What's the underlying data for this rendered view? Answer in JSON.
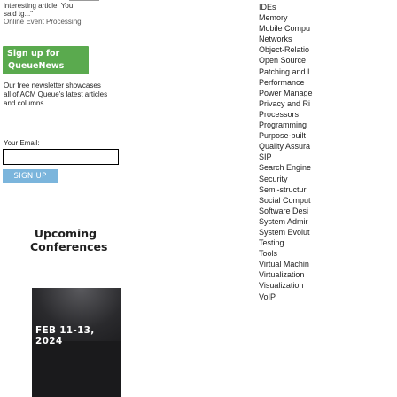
{
  "testimonial": {
    "line1": "interesting article! You",
    "line2": "said tg...\"",
    "byline": "Online Event Processing"
  },
  "newsletter": {
    "banner_line1": "Sign up for",
    "banner_line2": "QueueNews",
    "description": "Our free newsletter showcases all of ACM Queue's latest articles and columns.",
    "email_label": "Your Email:",
    "email_value": "",
    "signup_label": "SIGN UP"
  },
  "conferences": {
    "heading_line1": "Upcoming",
    "heading_line2": "Conferences",
    "event_date": "FEB 11-13, 2024"
  },
  "topics": [
    "IDEs",
    "Memory",
    "Mobile Compu",
    "Networks",
    "Object-Relatio",
    "Open Source",
    "Patching and I",
    "Performance",
    "Power Manage",
    "Privacy and Ri",
    "Processors",
    "Programming",
    "Purpose-built",
    "Quality Assura",
    "SIP",
    "Search Engine",
    "Security",
    "Semi-structur",
    "Social Comput",
    "Software Desi",
    "System Admir",
    "System Evolut",
    "Testing",
    "Tools",
    "Virtual Machin",
    "Virtualization",
    "Visualization",
    "VoIP"
  ],
  "colors": {
    "banner_green": "#5aaa4e",
    "button_blue": "#7bb5dc",
    "event_bg": "#1a1a1c"
  }
}
